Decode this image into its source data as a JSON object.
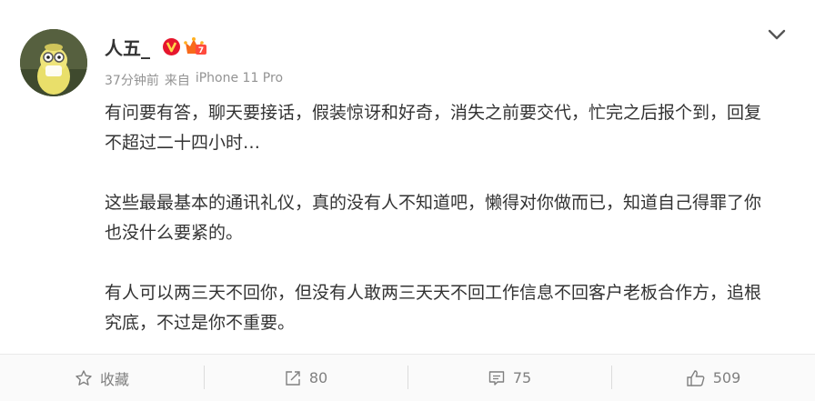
{
  "post": {
    "author": "人五_",
    "time": "37分钟前",
    "source_prefix": "来自",
    "device": "iPhone 11 Pro",
    "paragraphs": [
      "有问要有答，聊天要接话，假装惊讶和好奇，消失之前要交代，忙完之后报个到，回复不超过二十四小时…",
      "这些最最基本的通讯礼仪，真的没有人不知道吧，懒得对你做而已，知道自己得罪了你也没什么要紧的。",
      "有人可以两三天不回你，但没有人敢两三天天不回工作信息不回客户老板合作方，追根究底，不过是你不重要。"
    ]
  },
  "toolbar": {
    "favorite_label": "收藏",
    "repost_count": "80",
    "comment_count": "75",
    "like_count": "509"
  },
  "colors": {
    "verified_badge": "#e6162d",
    "text": "#333333",
    "meta": "#939393",
    "toolbar_text": "#808080"
  },
  "icons": [
    "avatar",
    "verified-v-icon",
    "member-crown-icon",
    "chevron-down-icon",
    "star-icon",
    "repost-icon",
    "comment-icon",
    "like-icon"
  ]
}
